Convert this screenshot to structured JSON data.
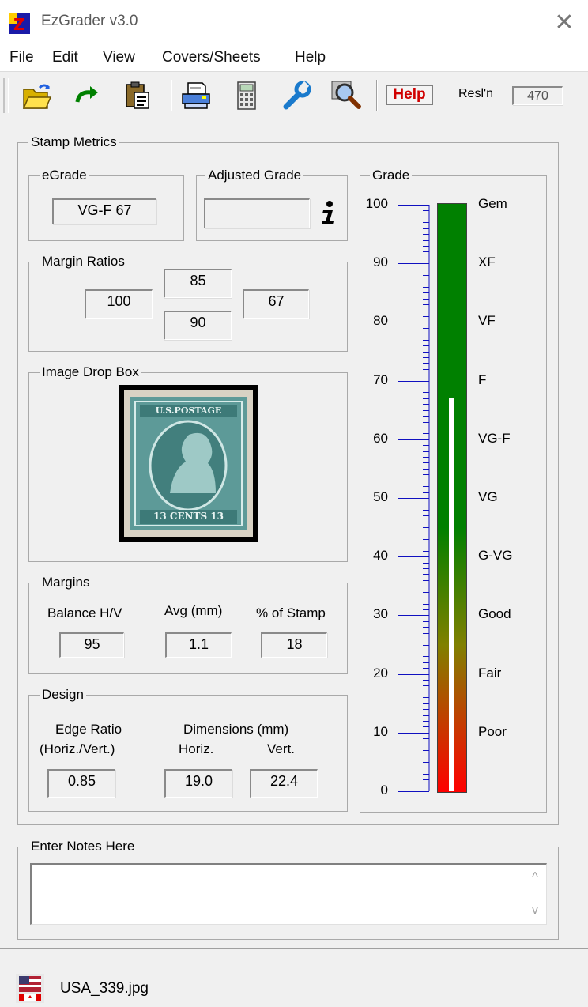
{
  "window": {
    "title": "EzGrader v3.0",
    "close_glyph": "✕",
    "app_icon": "ez-logo-icon"
  },
  "menu": [
    "File",
    "Edit",
    "View",
    "Covers/Sheets",
    "Help"
  ],
  "toolbar": {
    "icons": [
      "open-folder-icon",
      "redo-arrow-icon",
      "clipboard-paste-icon",
      "printer-icon",
      "calculator-icon",
      "wrench-icon",
      "magnifier-icon"
    ],
    "help_label": "Help",
    "resolution_label": "Resl'n",
    "resolution_value": "470"
  },
  "stamp_metrics": {
    "title": "Stamp Metrics",
    "egrade": {
      "title": "eGrade",
      "value": "VG-F  67"
    },
    "adjusted_grade": {
      "title": "Adjusted Grade",
      "value": "",
      "info_icon": "info-icon"
    },
    "margin_ratios": {
      "title": "Margin Ratios",
      "top": "85",
      "left": "100",
      "right": "67",
      "bottom": "90"
    },
    "image_drop_box": {
      "title": "Image Drop Box",
      "stamp_top_text": "U.S.POSTAGE",
      "stamp_bottom_text": "13 CENTS 13"
    },
    "margins": {
      "title": "Margins",
      "balance_label": "Balance H/V",
      "balance_value": "95",
      "avg_label": "Avg (mm)",
      "avg_value": "1.1",
      "pct_label": "% of Stamp",
      "pct_value": "18"
    },
    "design": {
      "title": "Design",
      "edge_ratio_label": "Edge Ratio",
      "edge_ratio_sublabel": "(Horiz./Vert.)",
      "edge_ratio_value": "0.85",
      "dimensions_label": "Dimensions (mm)",
      "horiz_label": "Horiz.",
      "horiz_value": "19.0",
      "vert_label": "Vert.",
      "vert_value": "22.4"
    }
  },
  "grade": {
    "title": "Grade",
    "scale_min": 0,
    "scale_max": 100,
    "indicator_value": 67,
    "ticks": [
      "100",
      "90",
      "80",
      "70",
      "60",
      "50",
      "40",
      "30",
      "20",
      "10",
      "0"
    ],
    "labels": [
      "Gem",
      "XF",
      "VF",
      "F",
      "VG-F",
      "VG",
      "G-VG",
      "Good",
      "Fair",
      "Poor"
    ],
    "bar_colors": {
      "top": "#008000",
      "bottom": "#ff0000"
    }
  },
  "notes": {
    "title": "Enter Notes Here",
    "value": "",
    "scroll_up": "^",
    "scroll_down": "v"
  },
  "status": {
    "file_icon": "stamp-file-icon",
    "file_name": "USA_339.jpg"
  }
}
